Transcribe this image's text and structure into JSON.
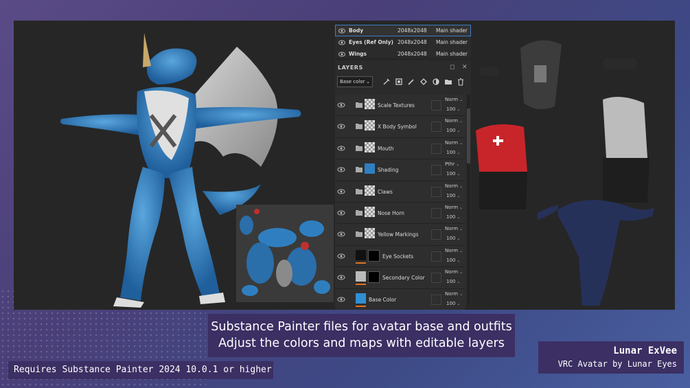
{
  "texture_sets": [
    {
      "name": "Body",
      "resolution": "2048x2048",
      "shader": "Main shader",
      "active": true
    },
    {
      "name": "Eyes (Ref Only)",
      "resolution": "2048x2048",
      "shader": "Main shader",
      "active": false
    },
    {
      "name": "Wings",
      "resolution": "2048x2048",
      "shader": "Main shader",
      "active": false
    }
  ],
  "layers_panel": {
    "title": "LAYERS",
    "channel_select": "Base color",
    "layers": [
      {
        "name": "Scale Textures",
        "blend": "Norm",
        "opacity": "100",
        "kind": "folder"
      },
      {
        "name": "X Body Symbol",
        "blend": "Norm",
        "opacity": "100",
        "kind": "folder"
      },
      {
        "name": "Mouth",
        "blend": "Norm",
        "opacity": "100",
        "kind": "folder"
      },
      {
        "name": "Shading",
        "blend": "Pthr",
        "opacity": "100",
        "kind": "folder"
      },
      {
        "name": "Claws",
        "blend": "Norm",
        "opacity": "100",
        "kind": "folder"
      },
      {
        "name": "Nose Horn",
        "blend": "Norm",
        "opacity": "100",
        "kind": "folder"
      },
      {
        "name": "Yellow Markings",
        "blend": "Norm",
        "opacity": "100",
        "kind": "folder"
      },
      {
        "name": "Eye Sockets",
        "blend": "Norm",
        "opacity": "100",
        "kind": "fill"
      },
      {
        "name": "Secondary Color",
        "blend": "Norm",
        "opacity": "100",
        "kind": "fill"
      },
      {
        "name": "Base Color",
        "blend": "Norm",
        "opacity": "100",
        "kind": "base"
      }
    ]
  },
  "caption": {
    "line1": "Substance Painter files for avatar base and outfits",
    "line2": "Adjust the colors and maps with editable layers"
  },
  "requirements": "Requires Substance Painter 2024 10.0.1 or higher",
  "credit": {
    "title": "Lunar ExVee",
    "subtitle": "VRC Avatar by Lunar Eyes"
  },
  "colors": {
    "accent": "#3d7ec4",
    "panel": "#2b2b2b",
    "caption_bg": "#3b2f63",
    "dragon_blue": "#2f7fc0",
    "fill_underline": "#e3741e"
  }
}
